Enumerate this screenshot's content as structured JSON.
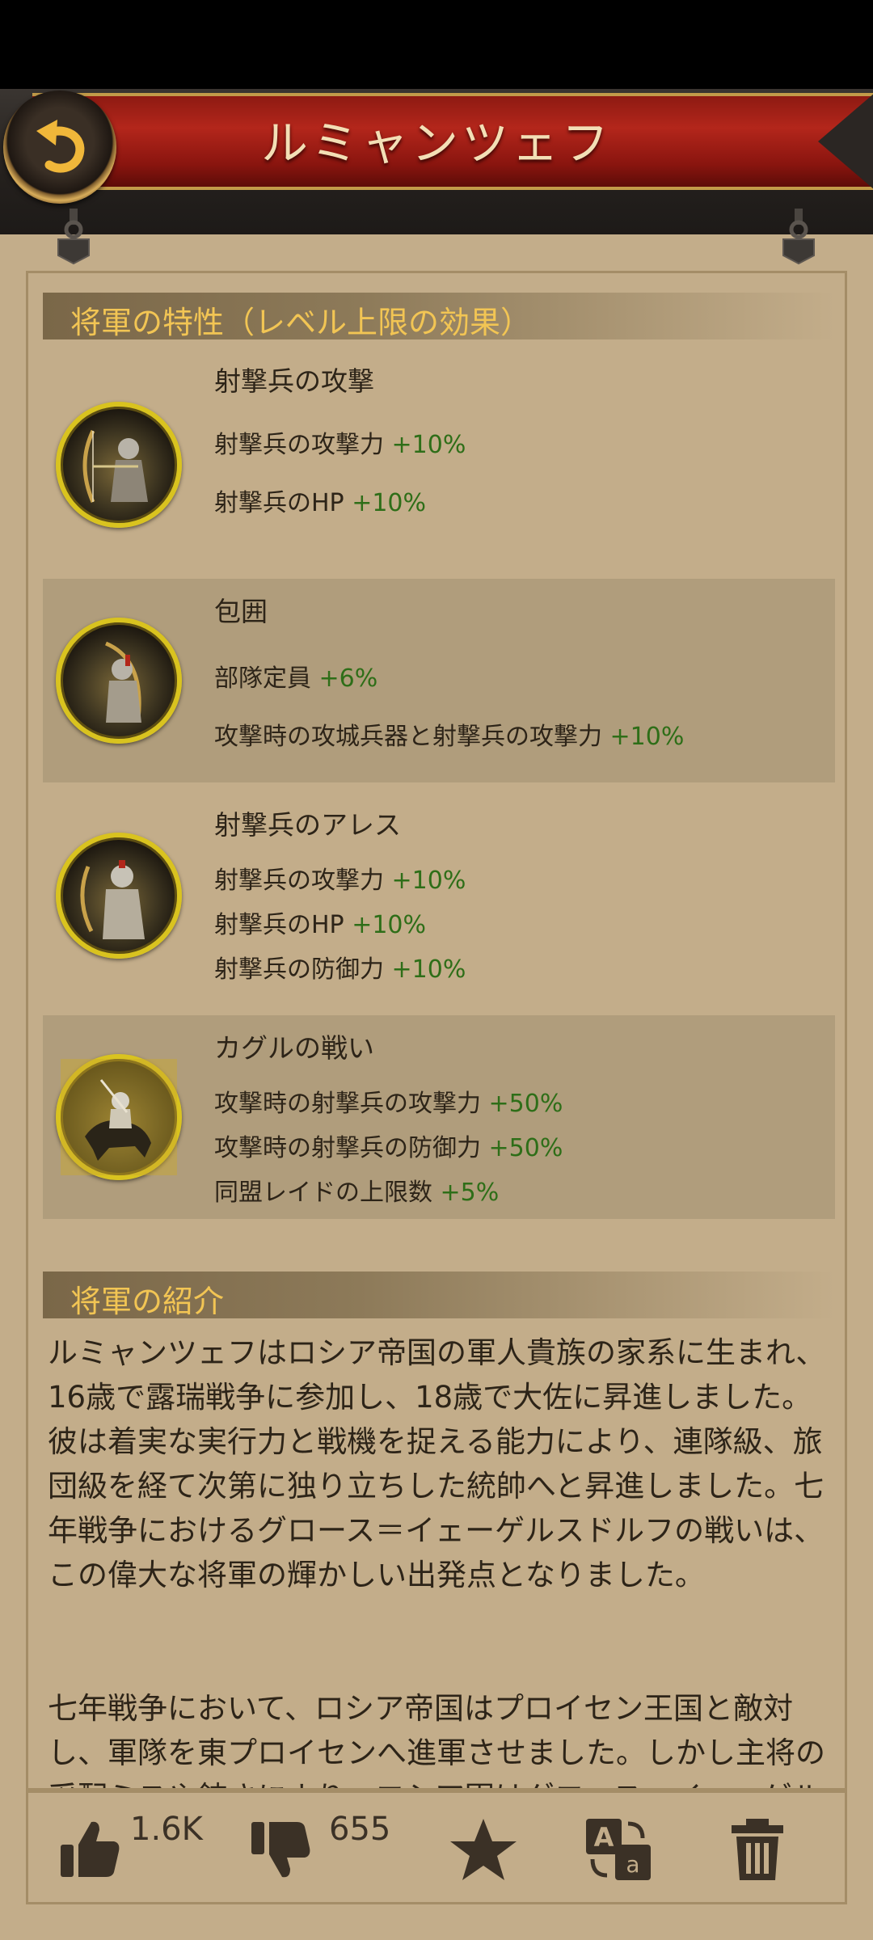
{
  "header": {
    "title": "ルミャンツェフ"
  },
  "traits_section": {
    "title": "将軍の特性（レベル上限の効果）",
    "traits": [
      {
        "name": "射撃兵の攻撃",
        "lines": [
          {
            "label": "射撃兵の攻撃力",
            "bonus": "+10%"
          },
          {
            "label": "射撃兵のHP",
            "bonus": "+10%"
          }
        ]
      },
      {
        "name": "包囲",
        "lines": [
          {
            "label": "部隊定員",
            "bonus": "+6%"
          },
          {
            "label": "攻撃時の攻城兵器と射撃兵の攻撃力",
            "bonus": "+10%"
          }
        ]
      },
      {
        "name": "射撃兵のアレス",
        "lines": [
          {
            "label": "射撃兵の攻撃力",
            "bonus": "+10%"
          },
          {
            "label": "射撃兵のHP",
            "bonus": "+10%"
          },
          {
            "label": "射撃兵の防御力",
            "bonus": "+10%"
          }
        ]
      },
      {
        "name": "カグルの戦い",
        "lines": [
          {
            "label": "攻撃時の射撃兵の攻撃力",
            "bonus": "+50%"
          },
          {
            "label": "攻撃時の射撃兵の防御力",
            "bonus": "+50%"
          },
          {
            "label": "同盟レイドの上限数",
            "bonus": "+5%"
          }
        ]
      }
    ]
  },
  "intro_section": {
    "title": "将軍の紹介",
    "paragraph1": "ルミャンツェフはロシア帝国の軍人貴族の家系に生まれ、16歳で露瑞戦争に参加し、18歳で大佐に昇進しました。彼は着実な実行力と戦機を捉える能力により、連隊級、旅団級を経て次第に独り立ちした統帥へと昇進しました。七年戦争におけるグロース＝イェーゲルスドルフの戦いは、この偉大な将軍の輝かしい出発点となりました。",
    "paragraph2": "七年戦争において、ロシア帝国はプロイセン王国と敵対し、軍隊を東プロイセンへ進軍させました。しかし主将の采配ミスや鈍さにより、ロシア軍はグロース＝イェーゲルスドルフで"
  },
  "footer": {
    "like_count": "1.6K",
    "dislike_count": "655"
  },
  "colors": {
    "background": "#c3ad8a",
    "bonus_green": "#2e6e18",
    "section_title": "#f2c554",
    "banner_red": "#b3261b"
  }
}
